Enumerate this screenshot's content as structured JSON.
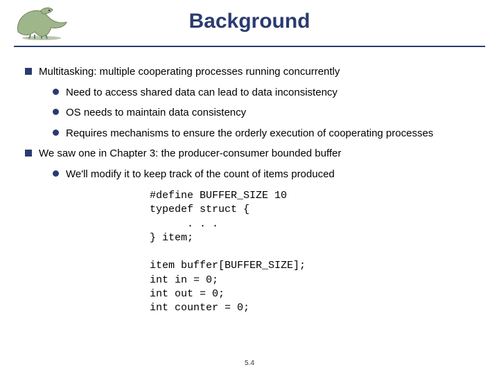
{
  "title": "Background",
  "bullets": {
    "b1": "Multitasking: multiple cooperating processes running concurrently",
    "b1a": "Need to access shared data can lead to data inconsistency",
    "b1b": "OS needs to maintain data consistency",
    "b1c": "Requires mechanisms to ensure the orderly execution of cooperating processes",
    "b2": "We saw one in Chapter 3: the producer-consumer bounded buffer",
    "b2a": "We'll modify it to keep track of the count of items produced"
  },
  "code": "#define BUFFER_SIZE 10\ntypedef struct {\n      . . .\n} item;\n\nitem buffer[BUFFER_SIZE];\nint in = 0;\nint out = 0;\nint counter = 0;",
  "footer": "5.4"
}
